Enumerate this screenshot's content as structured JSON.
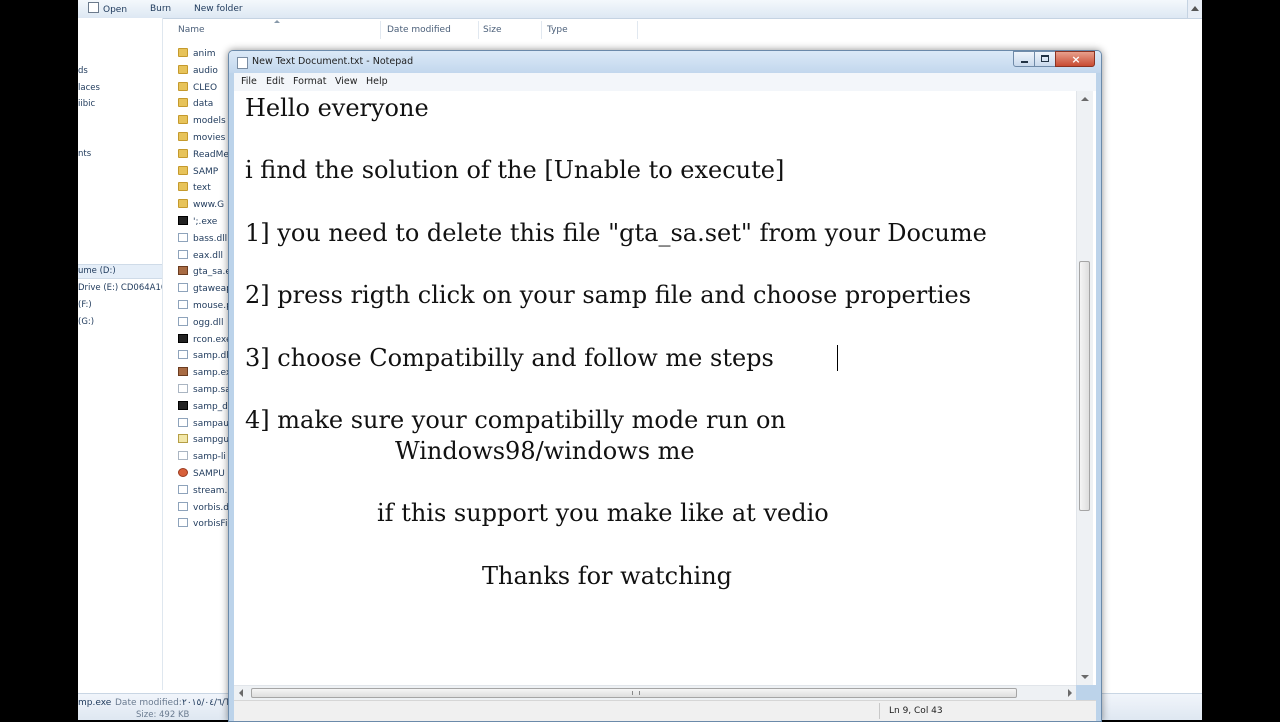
{
  "explorer": {
    "toolbar": {
      "open": "Open",
      "burn": "Burn",
      "new_folder": "New folder"
    },
    "nav_items": [
      "ds",
      "laces",
      "iibic",
      "nts",
      "ume (D:)",
      "Drive (E:) CD064A10",
      "(F:)",
      "(G:)"
    ],
    "columns": {
      "name": "Name",
      "date_modified": "Date modified",
      "size": "Size",
      "type": "Type"
    },
    "files": [
      {
        "name": "anim",
        "icon": "folder"
      },
      {
        "name": "audio",
        "icon": "folder"
      },
      {
        "name": "CLEO",
        "icon": "folder"
      },
      {
        "name": "data",
        "icon": "folder"
      },
      {
        "name": "models",
        "icon": "folder"
      },
      {
        "name": "movies",
        "icon": "folder"
      },
      {
        "name": "ReadMe",
        "icon": "folder"
      },
      {
        "name": "SAMP",
        "icon": "folder"
      },
      {
        "name": "text",
        "icon": "folder"
      },
      {
        "name": "www.G",
        "icon": "folder"
      },
      {
        "name": "';.exe",
        "icon": "exe"
      },
      {
        "name": "bass.dll",
        "icon": "dll"
      },
      {
        "name": "eax.dll",
        "icon": "dll"
      },
      {
        "name": "gta_sa.e",
        "icon": "img"
      },
      {
        "name": "gtaweap",
        "icon": "dll"
      },
      {
        "name": "mouse.p",
        "icon": "dll"
      },
      {
        "name": "ogg.dll",
        "icon": "dll"
      },
      {
        "name": "rcon.exe",
        "icon": "exe"
      },
      {
        "name": "samp.dll",
        "icon": "dll"
      },
      {
        "name": "samp.ex",
        "icon": "img"
      },
      {
        "name": "samp.sa",
        "icon": "doc"
      },
      {
        "name": "samp_d",
        "icon": "exe"
      },
      {
        "name": "sampau",
        "icon": "dll"
      },
      {
        "name": "sampgu",
        "icon": "cfg"
      },
      {
        "name": "samp-li",
        "icon": "doc"
      },
      {
        "name": "SAMPU",
        "icon": "orb"
      },
      {
        "name": "stream.i",
        "icon": "dll"
      },
      {
        "name": "vorbis.d",
        "icon": "dll"
      },
      {
        "name": "vorbisFi",
        "icon": "dll"
      }
    ],
    "status": {
      "filename": "mp.exe",
      "date_label": "Date modified:",
      "date_value": "٢٠١٥/٠٤/٦/TV",
      "size_line": "Size: 492 KB"
    }
  },
  "notepad": {
    "title": "New Text Document.txt - Notepad",
    "menu": [
      "File",
      "Edit",
      "Format",
      "View",
      "Help"
    ],
    "lines": [
      "Hello everyone",
      "i find the solution of the [Unable to execute]",
      "1] you need to delete this file  \"gta_sa.set\" from your Docume",
      "2] press rigth click on your samp file and choose properties",
      "3] choose Compatibilly and follow me steps",
      "4] make sure your compatibilly mode run on",
      "Windows98/windows me",
      "if this support you make like at vedio",
      "Thanks for watching"
    ],
    "status": "Ln 9, Col 43",
    "close_glyph": "×"
  }
}
